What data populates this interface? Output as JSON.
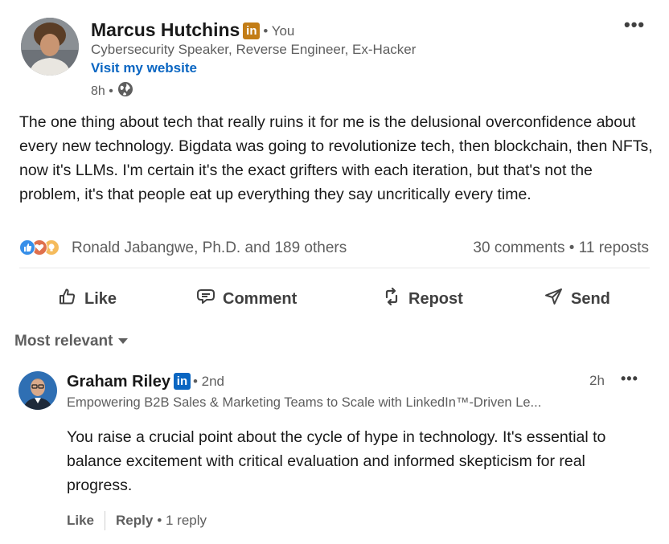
{
  "post": {
    "author": {
      "name": "Marcus Hutchins",
      "badge": "in",
      "badge_color": "#c37d16",
      "relation": "• You",
      "headline": "Cybersecurity Speaker, Reverse Engineer, Ex-Hacker",
      "website_label": "Visit my website"
    },
    "time": "8h •",
    "visibility_icon": "globe-icon",
    "more_label": "•••",
    "text": "The one thing about tech that really ruins it for me is the delusional overconfidence about every new technology. Bigdata was going to revolutionize tech, then blockchain, then NFTs, now it's LLMs. I'm certain it's the exact grifters with each iteration, but that's not the problem, it's that people eat up everything they say uncritically every time.",
    "reactions": {
      "icons": [
        "like-icon",
        "love-icon",
        "insightful-icon"
      ],
      "summary": "Ronald Jabangwe, Ph.D. and 189 others",
      "comments": "30 comments",
      "separator": "•",
      "reposts": "11 reposts"
    },
    "actions": {
      "like": "Like",
      "comment": "Comment",
      "repost": "Repost",
      "send": "Send"
    }
  },
  "comments_section": {
    "sort_label": "Most relevant",
    "comments": [
      {
        "author": "Graham Riley",
        "badge": "in",
        "badge_color": "#0a66c2",
        "relation": "• 2nd",
        "headline": "Empowering B2B Sales & Marketing Teams to Scale with LinkedIn™-Driven Le...",
        "time": "2h",
        "more_label": "•••",
        "text": "You raise a crucial point about the cycle of hype in technology. It's essential to balance excitement with critical evaluation and informed skepticism for real progress.",
        "like_label": "Like",
        "reply_label": "Reply",
        "reply_count": "• 1 reply"
      }
    ]
  },
  "colors": {
    "link": "#0a66c2",
    "text": "#191919",
    "muted": "#5e5e5e"
  }
}
